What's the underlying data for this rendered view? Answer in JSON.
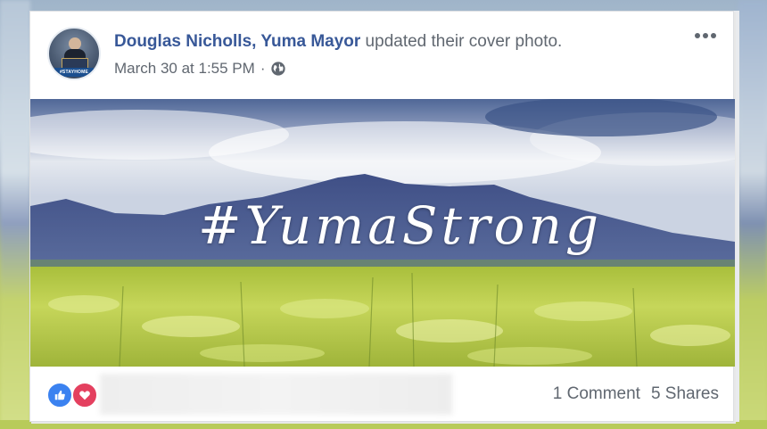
{
  "post": {
    "author_name": "Douglas Nicholls, Yuma Mayor",
    "action_text": " updated their cover photo.",
    "timestamp": "March 30 at 1:55 PM",
    "separator": " ·",
    "privacy_icon": "globe-icon",
    "more_options_icon": "more-options-icon",
    "avatar_banner_text": "#STAYHOME"
  },
  "cover_photo": {
    "hashtag_text": "#YumaStrong"
  },
  "footer": {
    "reaction_icons": [
      "like-icon",
      "love-icon"
    ],
    "comments_label": "1 Comment",
    "shares_label": "5 Shares"
  },
  "colors": {
    "link": "#385898",
    "secondary_text": "#606770",
    "like": "#3b82f0",
    "love": "#e4405f"
  }
}
